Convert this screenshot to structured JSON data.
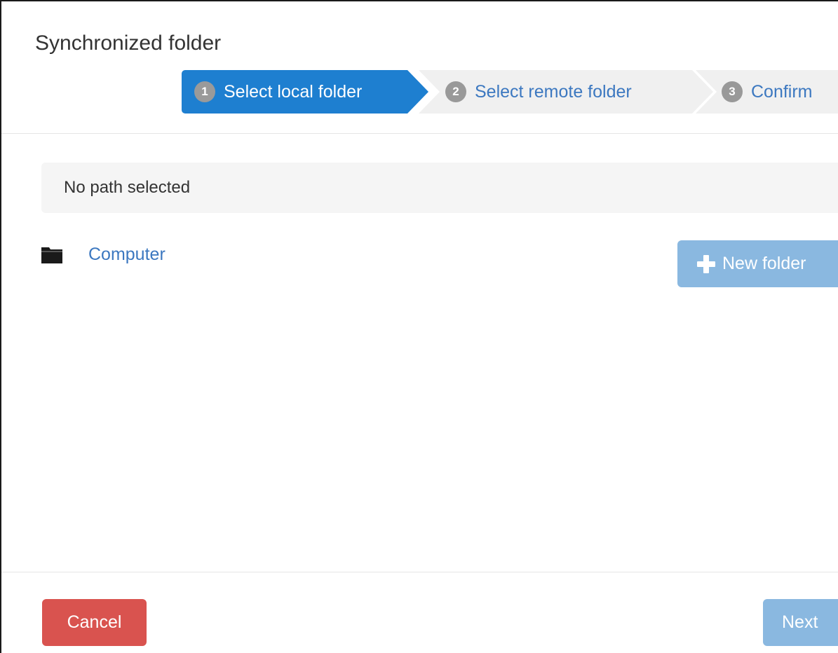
{
  "dialog": {
    "title": "Synchronized folder"
  },
  "wizard": {
    "steps": [
      {
        "number": "1",
        "label": "Select local folder",
        "state": "active"
      },
      {
        "number": "2",
        "label": "Select remote folder",
        "state": "inactive"
      },
      {
        "number": "3",
        "label": "Confirm",
        "state": "inactive"
      }
    ]
  },
  "path_bar": {
    "text": "No path selected"
  },
  "tree": {
    "items": [
      {
        "label": "Computer",
        "icon": "folder-icon"
      }
    ]
  },
  "actions": {
    "new_folder_label": "New folder",
    "new_folder_icon": "plus-icon",
    "cancel_label": "Cancel",
    "next_label": "Next"
  },
  "colors": {
    "active_step": "#1e7fd0",
    "inactive_step": "#f0f0f0",
    "link": "#3c78c0",
    "primary_disabled": "#8ab8e0",
    "danger": "#d9534f"
  }
}
